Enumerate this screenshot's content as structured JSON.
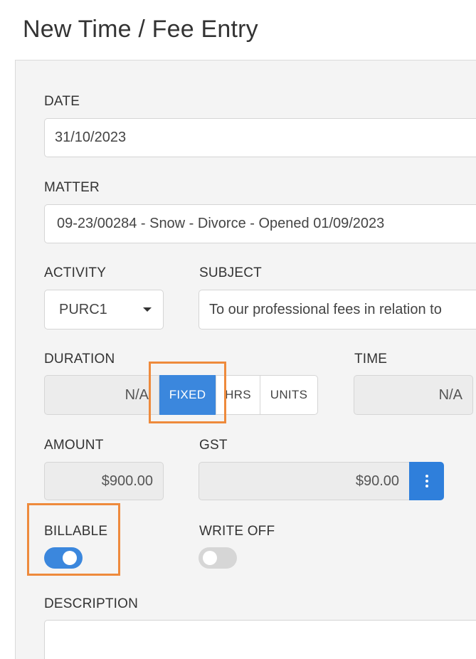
{
  "page": {
    "title": "New Time / Fee Entry"
  },
  "form": {
    "date": {
      "label": "DATE",
      "value": "31/10/2023"
    },
    "matter": {
      "label": "MATTER",
      "value": "09-23/00284 - Snow - Divorce - Opened 01/09/2023"
    },
    "activity": {
      "label": "ACTIVITY",
      "value": "PURC1"
    },
    "subject": {
      "label": "SUBJECT",
      "value": "To our professional fees in relation to"
    },
    "duration": {
      "label": "DURATION",
      "value": "N/A",
      "modes": {
        "fixed": "FIXED",
        "hrs": "HRS",
        "units": "UNITS"
      },
      "selected": "FIXED"
    },
    "time": {
      "label": "TIME",
      "value": "N/A"
    },
    "amount": {
      "label": "AMOUNT",
      "value": "$900.00"
    },
    "gst": {
      "label": "GST",
      "value": "$90.00"
    },
    "billable": {
      "label": "BILLABLE",
      "on": true
    },
    "write_off": {
      "label": "WRITE OFF",
      "on": false
    },
    "description": {
      "label": "DESCRIPTION",
      "value": ""
    }
  },
  "colors": {
    "accent": "#3b87dd",
    "highlight": "#ee8a3c"
  }
}
